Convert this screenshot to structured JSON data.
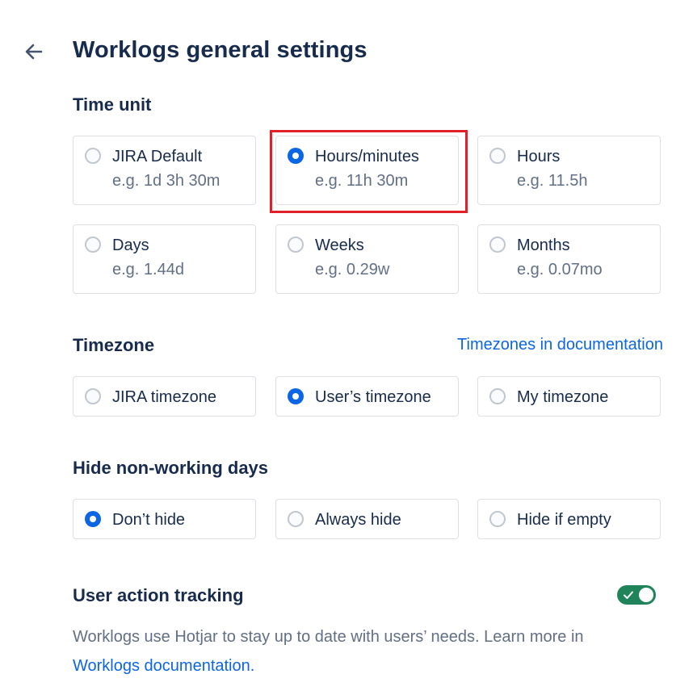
{
  "header": {
    "title": "Worklogs general settings",
    "back_icon": "arrow-left-icon"
  },
  "time_unit": {
    "title": "Time unit",
    "selected": "Hours/minutes",
    "options": [
      {
        "label": "JIRA Default",
        "example": "e.g. 1d 3h 30m",
        "checked": false
      },
      {
        "label": "Hours/minutes",
        "example": "e.g. 11h 30m",
        "checked": true
      },
      {
        "label": "Hours",
        "example": "e.g. 11.5h",
        "checked": false
      },
      {
        "label": "Days",
        "example": "e.g. 1.44d",
        "checked": false
      },
      {
        "label": "Weeks",
        "example": "e.g. 0.29w",
        "checked": false
      },
      {
        "label": "Months",
        "example": "e.g. 0.07mo",
        "checked": false
      }
    ]
  },
  "timezone": {
    "title": "Timezone",
    "doc_link": "Timezones in documentation",
    "selected": "User’s timezone",
    "options": [
      {
        "label": "JIRA timezone",
        "checked": false
      },
      {
        "label": "User’s timezone",
        "checked": true
      },
      {
        "label": "My timezone",
        "checked": false
      }
    ]
  },
  "hide_days": {
    "title": "Hide non-working days",
    "selected": "Don’t hide",
    "options": [
      {
        "label": "Don’t hide",
        "checked": true
      },
      {
        "label": "Always hide",
        "checked": false
      },
      {
        "label": "Hide if empty",
        "checked": false
      }
    ]
  },
  "tracking": {
    "title": "User action tracking",
    "enabled": true,
    "description": "Worklogs use Hotjar to stay up to date with users’ needs. Learn more in",
    "link": "Worklogs documentation."
  },
  "colors": {
    "accent": "#0c66e4",
    "toggle_on": "#1f845a",
    "highlight": "#e0202b",
    "text_primary": "#172b4d",
    "text_secondary": "#626f86"
  }
}
